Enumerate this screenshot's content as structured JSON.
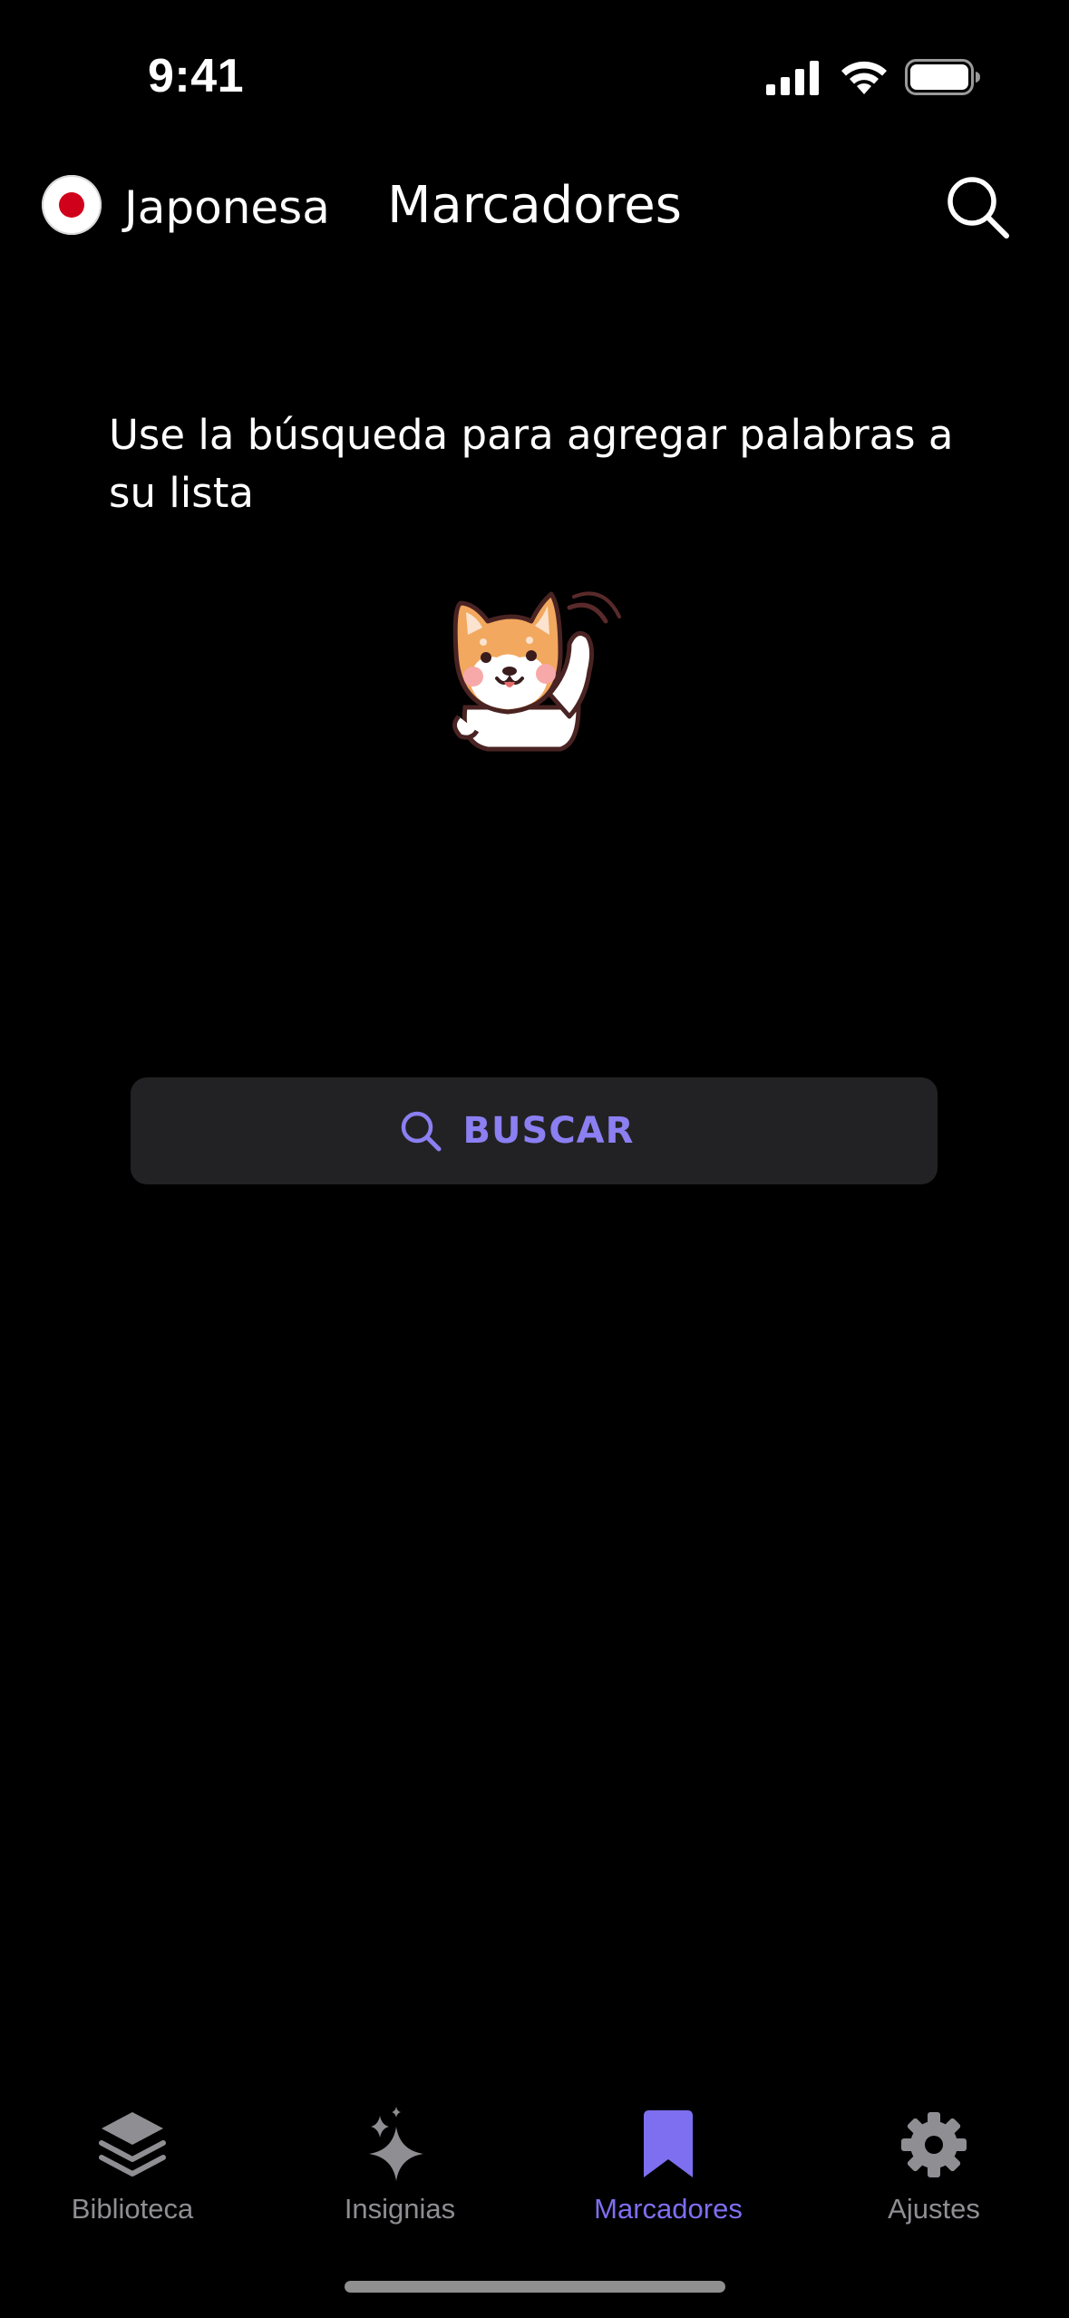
{
  "status_bar": {
    "time": "9:41"
  },
  "header": {
    "language_label": "Japonesa",
    "title": "Marcadores"
  },
  "main": {
    "empty_message": "Use la búsqueda para agregar palabras a su lista",
    "search_button_label": "BUSCAR"
  },
  "tab_bar": {
    "items": [
      {
        "label": "Biblioteca",
        "icon": "layers-icon",
        "active": false
      },
      {
        "label": "Insignias",
        "icon": "sparkles-icon",
        "active": false
      },
      {
        "label": "Marcadores",
        "icon": "bookmark-icon",
        "active": true
      },
      {
        "label": "Ajustes",
        "icon": "gear-icon",
        "active": false
      }
    ]
  },
  "colors": {
    "background": "#000000",
    "accent": "#7d6ff0",
    "inactive_tab": "#8e8e93",
    "button_bg": "#222224",
    "flag_red": "#d0021b"
  }
}
